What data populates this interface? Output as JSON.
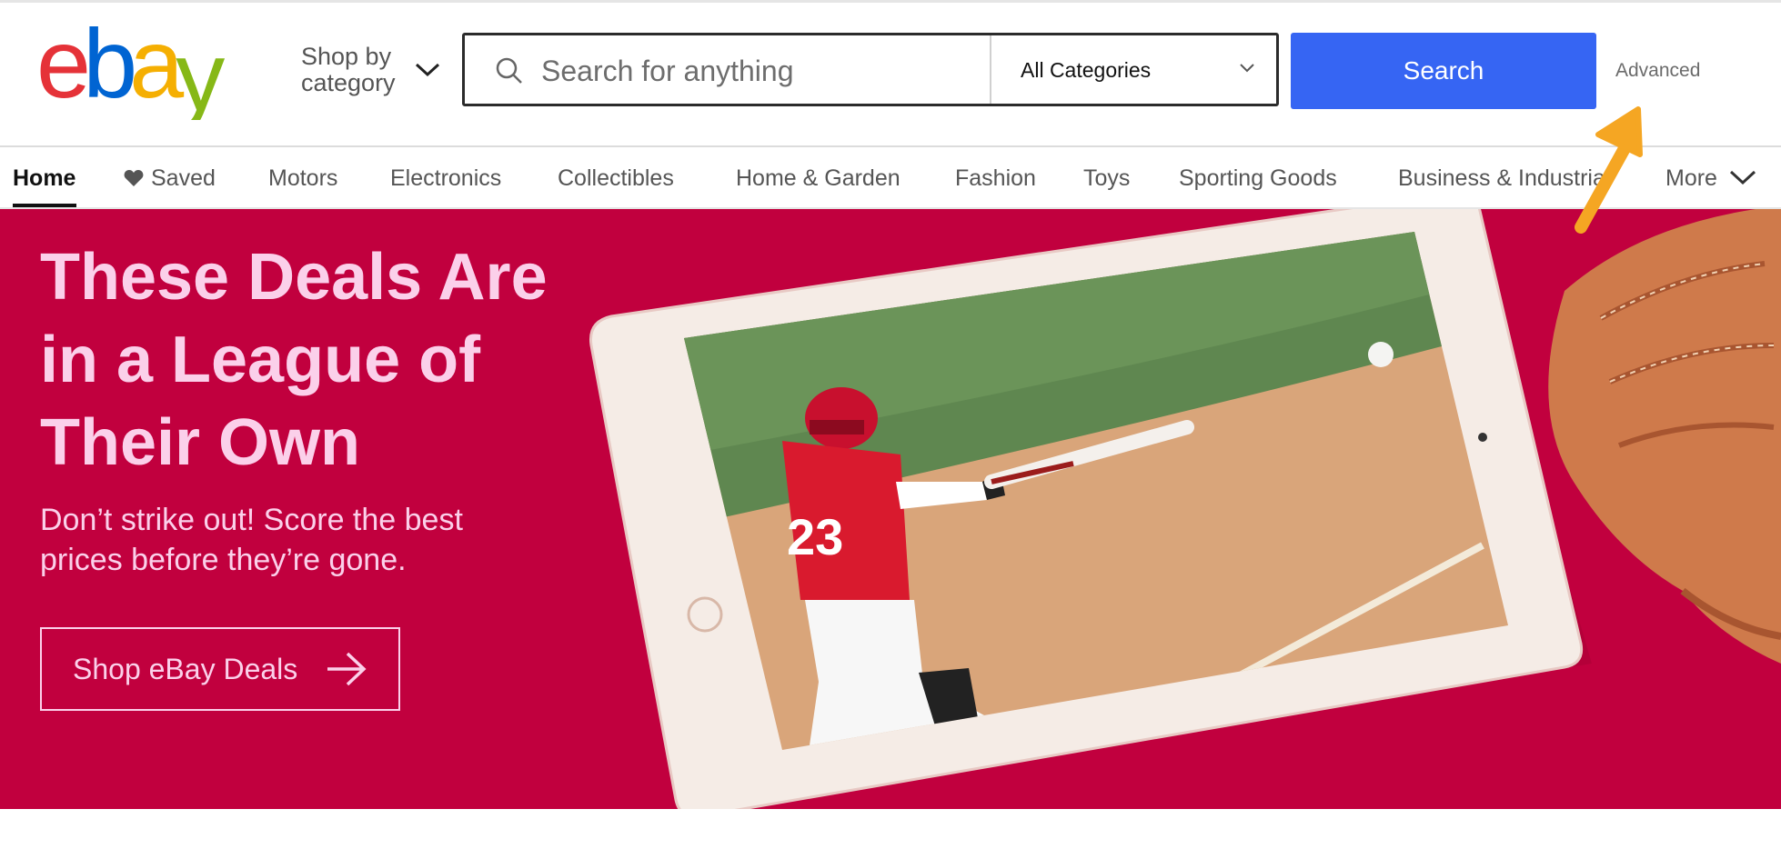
{
  "header": {
    "logo_text": "ebay",
    "shop_by_category": "Shop by category",
    "search": {
      "placeholder": "Search for anything",
      "category_selected": "All Categories",
      "button_label": "Search"
    },
    "advanced_link": "Advanced"
  },
  "nav": {
    "items": [
      {
        "label": "Home",
        "active": true
      },
      {
        "label": "Saved",
        "icon": "heart-icon"
      },
      {
        "label": "Motors"
      },
      {
        "label": "Electronics"
      },
      {
        "label": "Collectibles"
      },
      {
        "label": "Home & Garden"
      },
      {
        "label": "Fashion"
      },
      {
        "label": "Toys"
      },
      {
        "label": "Sporting Goods"
      },
      {
        "label": "Business & Industrial"
      },
      {
        "label": "More",
        "icon": "chevron-down-icon"
      }
    ]
  },
  "hero": {
    "title": "These Deals Are in a League of Their Own",
    "subtitle": "Don’t strike out! Score the best prices before they’re gone.",
    "cta_label": "Shop eBay Deals",
    "player_number": "23",
    "background_color": "#c1003e",
    "text_color": "#fbd0ea"
  },
  "colors": {
    "search_button": "#3665f3",
    "logo_e": "#e53238",
    "logo_b": "#0064d2",
    "logo_a": "#f5af02",
    "logo_y": "#86b817",
    "annotation_arrow": "#f5a623"
  }
}
